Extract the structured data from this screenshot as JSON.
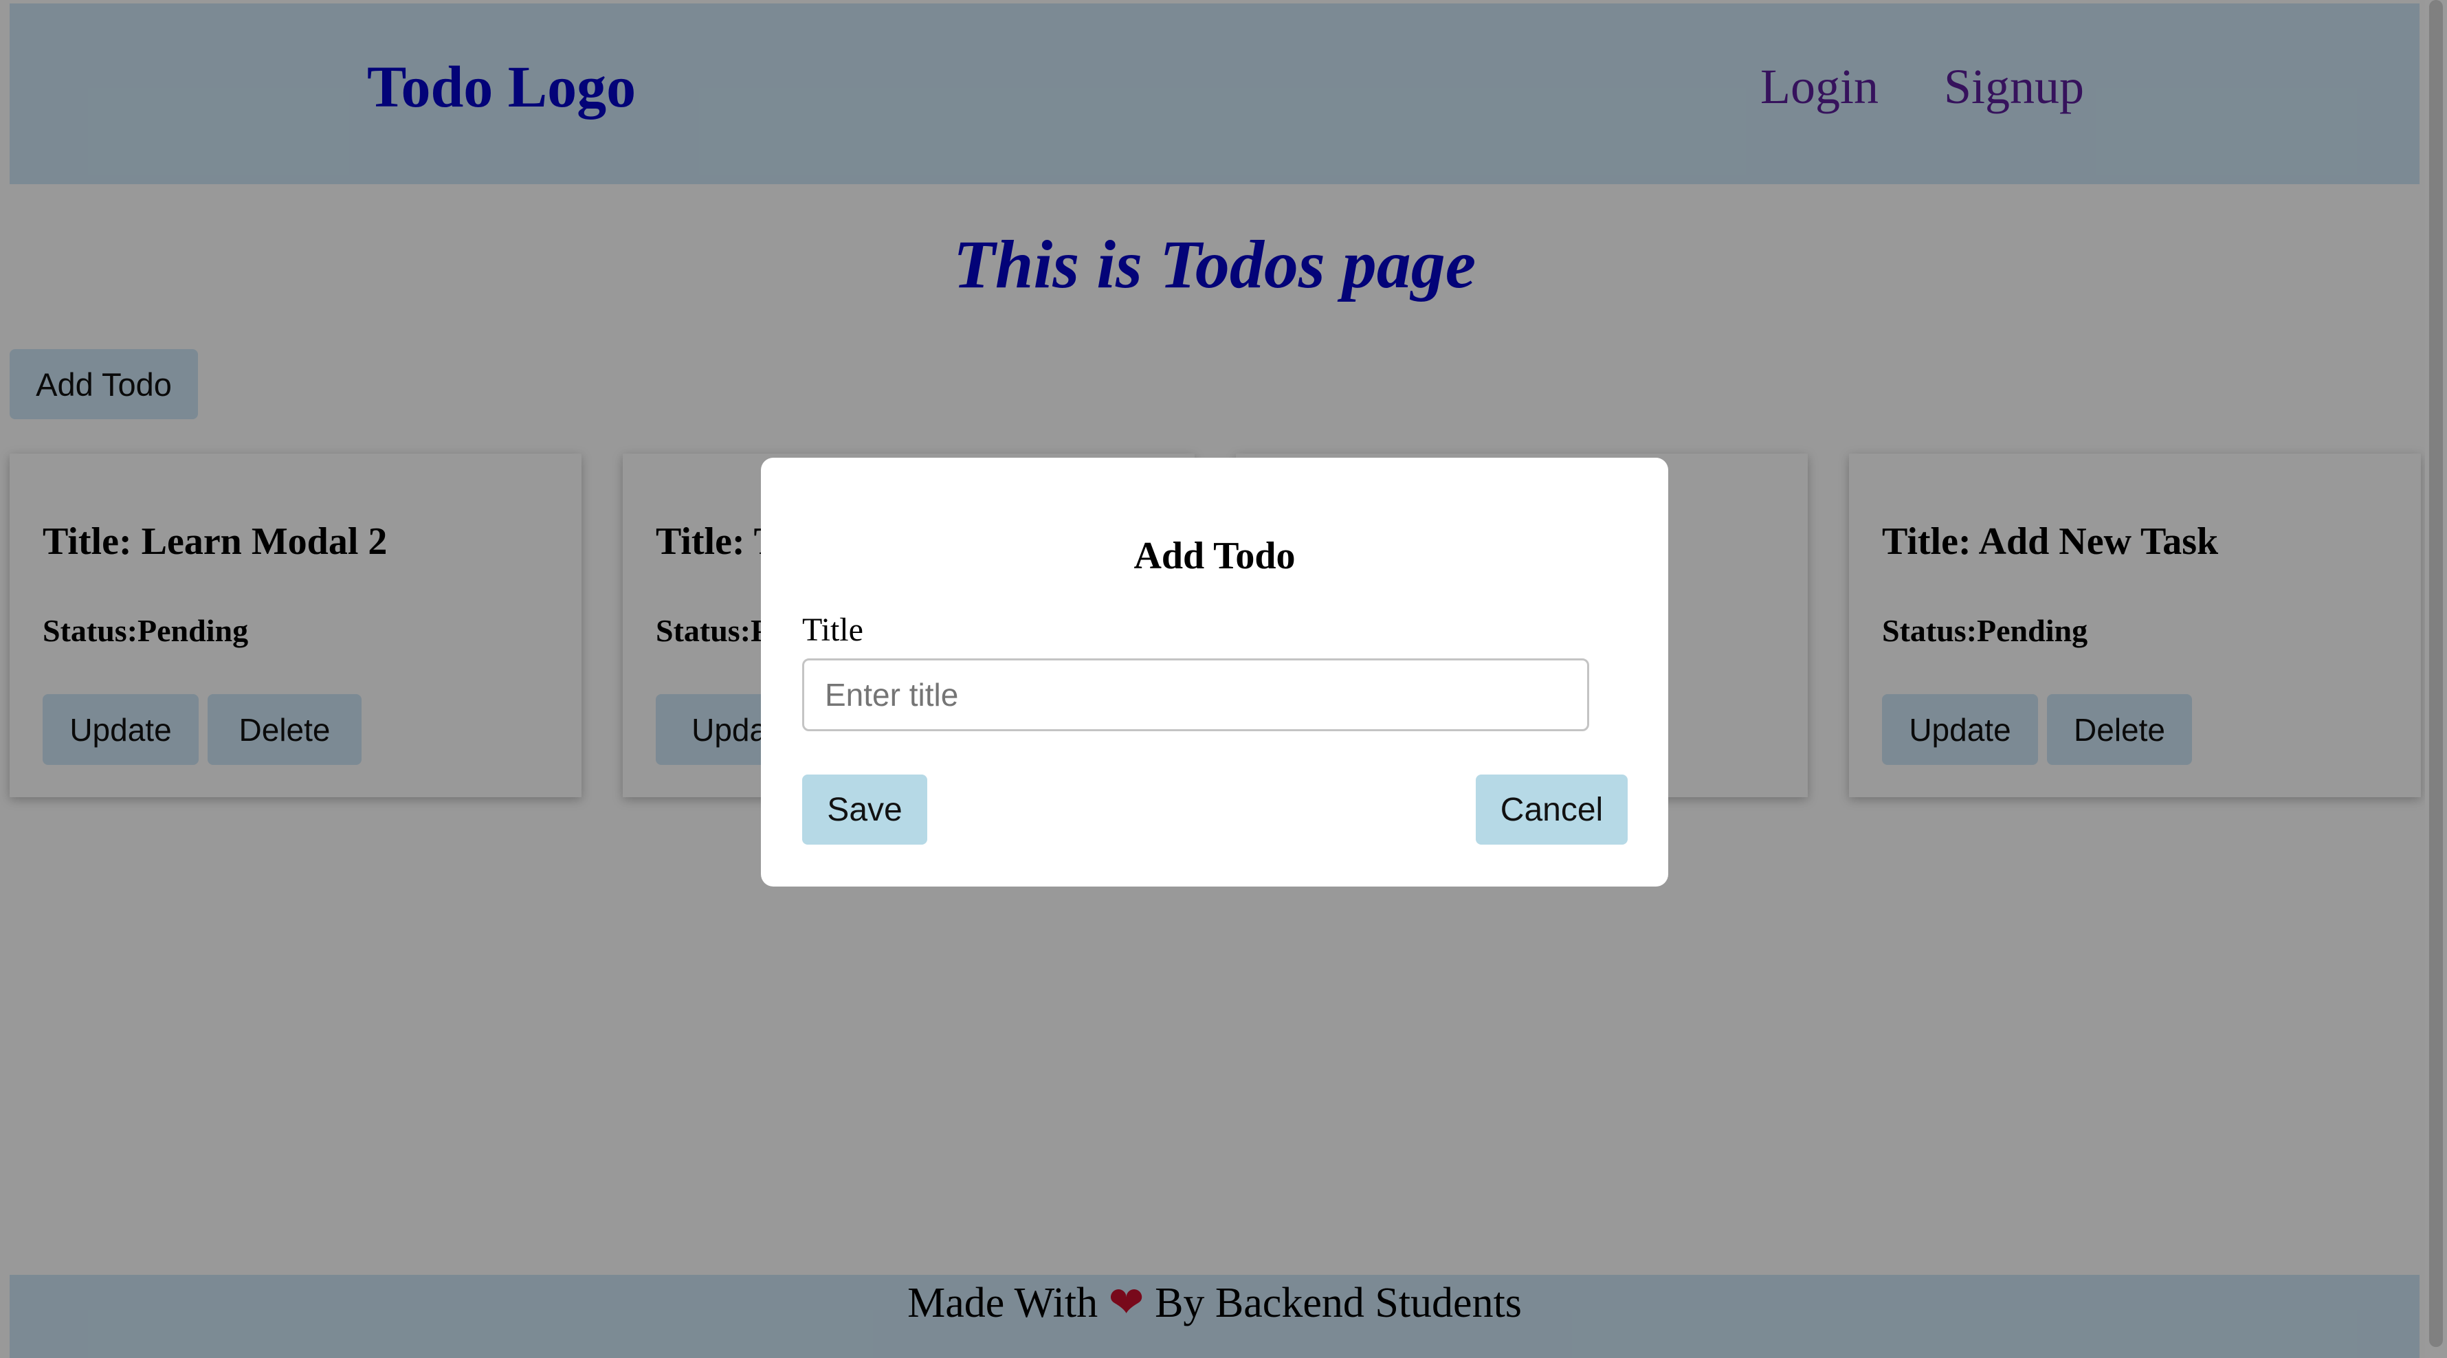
{
  "header": {
    "logo": "Todo Logo",
    "nav": {
      "login": "Login",
      "signup": "Signup"
    }
  },
  "main": {
    "page_title": "This is Todos page",
    "add_todo_label": "Add Todo",
    "todos": [
      {
        "title": "Title: Learn Modal 2",
        "status": "Status:Pending",
        "update_label": "Update",
        "delete_label": "Delete"
      },
      {
        "title": "Title: T",
        "status": "Status:P",
        "update_label": "Updat",
        "delete_label": ""
      },
      {
        "title": "",
        "status": "",
        "update_label": "",
        "delete_label": ""
      },
      {
        "title": "Title: Add New Task",
        "status": "Status:Pending",
        "update_label": "Update",
        "delete_label": "Delete"
      }
    ]
  },
  "modal": {
    "title": "Add Todo",
    "field_label": "Title",
    "input_value": "",
    "input_placeholder": "Enter title",
    "save_label": "Save",
    "cancel_label": "Cancel"
  },
  "footer": {
    "text_before": "Made With",
    "heart_icon": "heart-icon",
    "text_after": "By Backend Students"
  },
  "colors": {
    "navbar_bg": "#cfe7f7",
    "logo": "#0505c9",
    "nav_link": "#5a1f9a",
    "modal_button_bg": "#b6d9e6",
    "overlay": "rgba(0,0,0,0.4)",
    "heart": "#c8102e"
  }
}
